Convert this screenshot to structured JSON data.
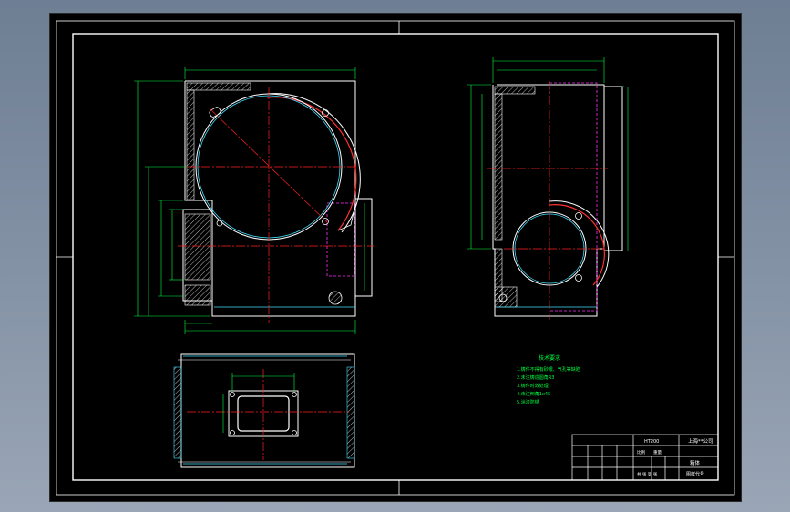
{
  "drawing": {
    "background": "#000000",
    "colors": {
      "outline": "#ffffff",
      "centerline": "#ff2020",
      "dimension": "#00ff40",
      "hidden": "#ff30ff",
      "hatch": "#ffffff",
      "cyan": "#40e0ff"
    },
    "notes": {
      "title": "技术要求",
      "lines": [
        "1.铸件不得有砂眼、气孔等缺陷",
        "2.未注铸造圆角R3",
        "3.铸件时效处理",
        "4.未注倒角1x45",
        "5.涂漆防锈"
      ]
    },
    "title_block": {
      "company": "上海**公司",
      "part_name": "箱体",
      "material": "HT200",
      "drawing_no": "图样代号",
      "scale_label": "比例",
      "weight_label": "重量",
      "sheet_label": "共 张 第 张"
    }
  }
}
